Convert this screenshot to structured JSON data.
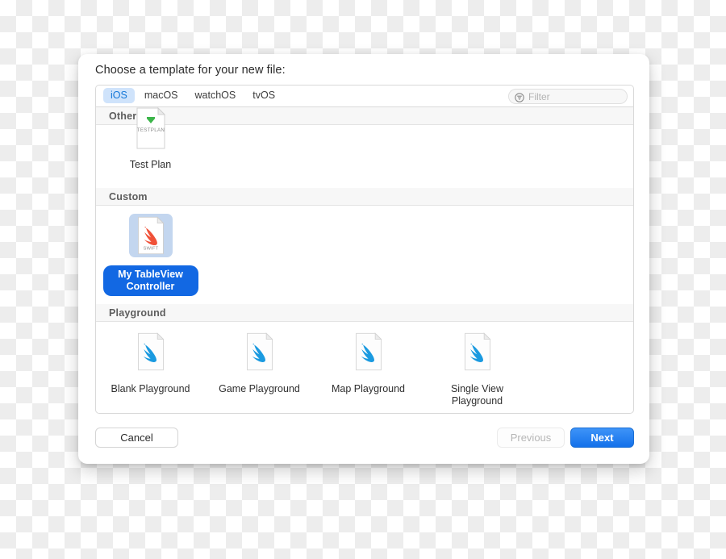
{
  "dialog": {
    "title": "Choose a template for your new file:"
  },
  "platform_tabs": [
    {
      "label": "iOS",
      "selected": true
    },
    {
      "label": "macOS",
      "selected": false
    },
    {
      "label": "watchOS",
      "selected": false
    },
    {
      "label": "tvOS",
      "selected": false
    }
  ],
  "filter": {
    "placeholder": "Filter",
    "value": "",
    "icon": "filter-icon"
  },
  "sections": [
    {
      "name": "other",
      "header": "Other",
      "clipped": true,
      "items": [
        {
          "label": "Test Plan",
          "icon": "testplan-document-icon",
          "selected": false
        }
      ]
    },
    {
      "name": "custom",
      "header": "Custom",
      "clipped": false,
      "items": [
        {
          "label": "My TableView Controller",
          "icon": "swift-file-icon",
          "selected": true
        }
      ]
    },
    {
      "name": "playground",
      "header": "Playground",
      "clipped": false,
      "items": [
        {
          "label": "Blank Playground",
          "icon": "swift-playground-icon",
          "selected": false
        },
        {
          "label": "Game Playground",
          "icon": "swift-playground-icon",
          "selected": false
        },
        {
          "label": "Map Playground",
          "icon": "swift-playground-icon",
          "selected": false
        },
        {
          "label": "Single View Playground",
          "icon": "swift-playground-icon",
          "selected": false
        }
      ]
    }
  ],
  "footer": {
    "cancel_label": "Cancel",
    "previous_label": "Previous",
    "previous_disabled": true,
    "next_label": "Next"
  },
  "colors": {
    "accent_blue": "#1268e3",
    "next_button_blue": "#1471ea",
    "tab_selected_bg": "#cfe3fb",
    "selection_bg": "#c3d6ef",
    "swift_orange": "#f05138",
    "swift_blue": "#1a9ae0",
    "testplan_green": "#3cb54a"
  }
}
